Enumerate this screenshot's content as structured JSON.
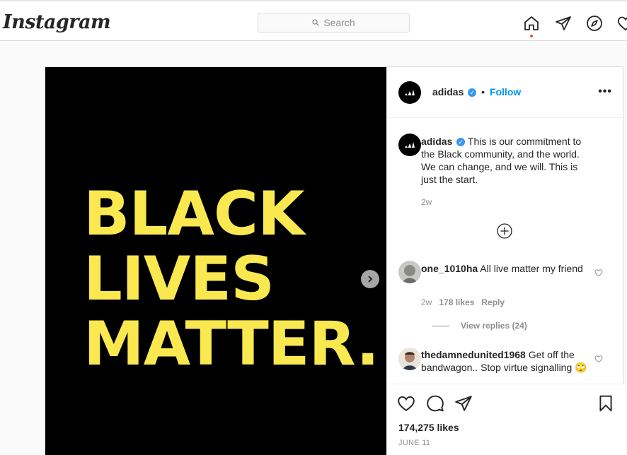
{
  "topbar": {
    "logo": "Instagram",
    "search_placeholder": "Search",
    "icons": [
      "home-icon",
      "direct-icon",
      "explore-icon",
      "activity-icon"
    ]
  },
  "post": {
    "media_text": [
      "BLACK",
      "LIVES",
      "MATTER."
    ],
    "media_text_color": "#f9e84f",
    "media_bg_color": "#000000",
    "author": "adidas",
    "follow_label": "Follow",
    "separator": "•",
    "caption": {
      "user": "adidas",
      "text": "This is our commitment to the Black community, and the world. We can change, and we will. This is just the start.",
      "time": "2w"
    },
    "comments": [
      {
        "user": "one_1010ha",
        "text": "All live matter my friend",
        "time": "2w",
        "likes": "178 likes",
        "reply_label": "Reply",
        "view_replies": "View replies (24)"
      },
      {
        "user": "thedamnedunited1968",
        "text": "Get off the bandwagon.. Stop virtue signalling 🙄"
      }
    ],
    "likes_count": "174,275 likes",
    "date": "JUNE 11"
  },
  "colors": {
    "accent": "#0095f6",
    "verified": "#3897f0",
    "notification_dot": "#ed4956"
  }
}
